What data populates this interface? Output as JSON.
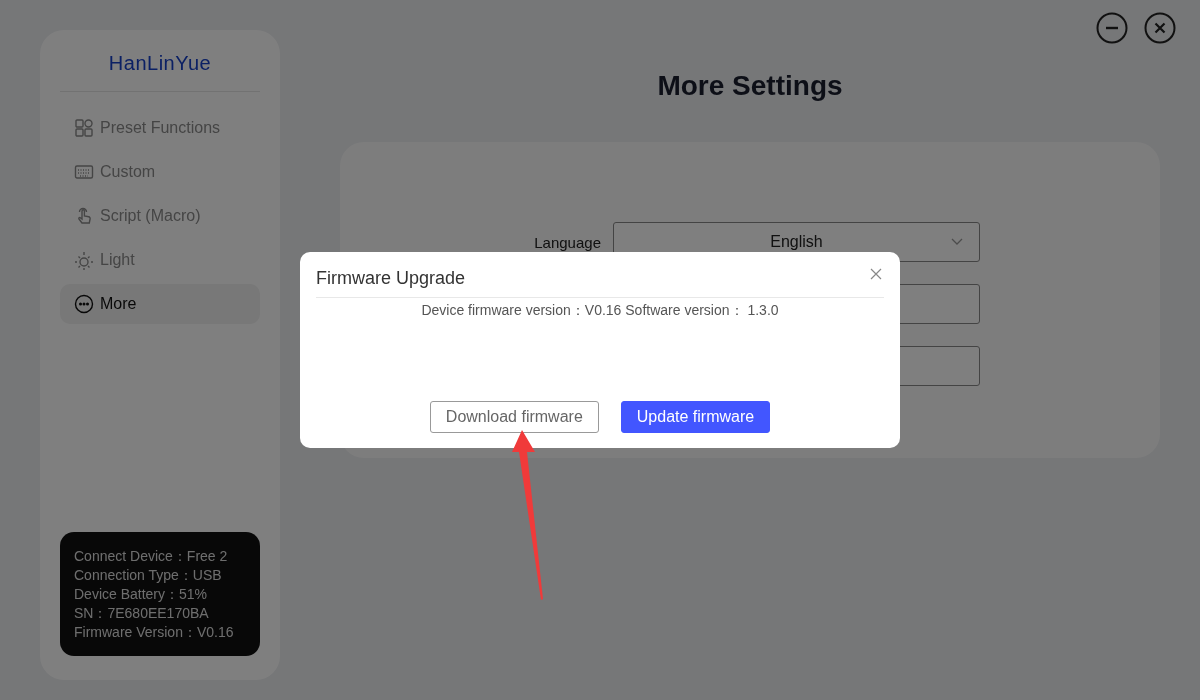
{
  "logo": "HanLinYue",
  "nav": [
    {
      "label": "Preset Functions",
      "kind": "grid",
      "selected": false
    },
    {
      "label": "Custom",
      "kind": "keyboard",
      "selected": false
    },
    {
      "label": "Script (Macro)",
      "kind": "hand",
      "selected": false
    },
    {
      "label": "Light",
      "kind": "light",
      "selected": false
    },
    {
      "label": "More",
      "kind": "more",
      "selected": true
    }
  ],
  "device_info": [
    "Connect Device：Free 2",
    "Connection Type：USB",
    "Device Battery：51%",
    "SN：7E680EE170BA",
    "Firmware Version：V0.16"
  ],
  "title": "More Settings",
  "fields": [
    {
      "kind": "select",
      "label": "Language",
      "value": "English"
    },
    {
      "kind": "input"
    },
    {
      "kind": "input"
    }
  ],
  "dialog": {
    "title": "Firmware Upgrade",
    "text": "Device firmware version：V0.16 Software version： 1.3.0",
    "buttons": [
      {
        "label": "Download firmware",
        "kind": "secondary"
      },
      {
        "label": "Update firmware",
        "kind": "primary"
      }
    ]
  },
  "annotation": {
    "kind": "arrow"
  }
}
